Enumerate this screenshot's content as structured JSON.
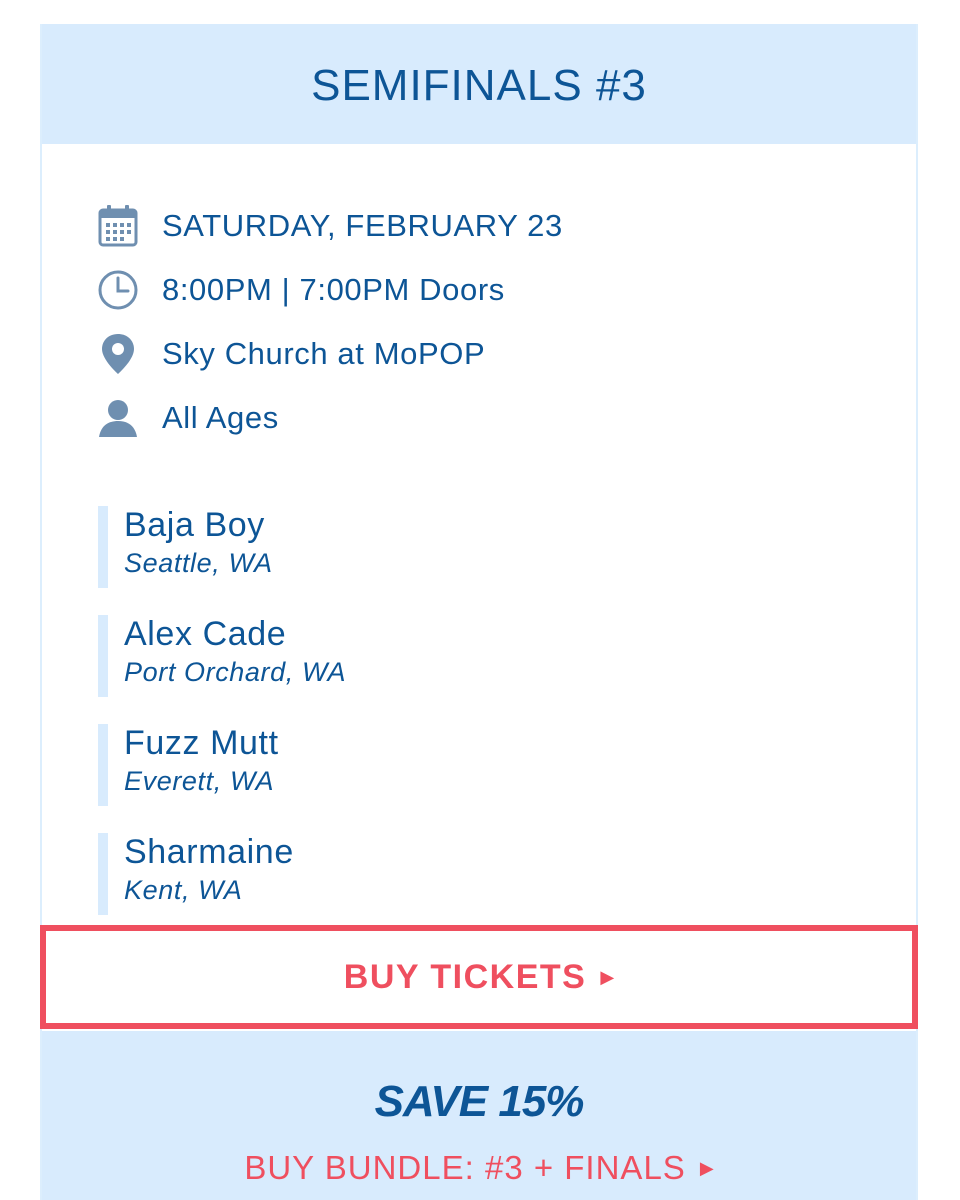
{
  "event": {
    "title": "SEMIFINALS #3",
    "date": "SATURDAY, FEBRUARY 23",
    "time": "8:00PM | 7:00PM Doors",
    "venue": "Sky Church at MoPOP",
    "ages": "All Ages"
  },
  "lineup": [
    {
      "name": "Baja Boy",
      "origin": "Seattle, WA"
    },
    {
      "name": "Alex Cade",
      "origin": "Port Orchard, WA"
    },
    {
      "name": "Fuzz Mutt",
      "origin": "Everett, WA"
    },
    {
      "name": "Sharmaine",
      "origin": "Kent, WA"
    }
  ],
  "actions": {
    "buy_tickets": "BUY TICKETS",
    "save_text": "SAVE 15%",
    "bundle": "BUY BUNDLE: #3 + FINALS"
  },
  "icons": {
    "date": "calendar-icon",
    "time": "clock-icon",
    "venue": "location-pin-icon",
    "ages": "person-icon",
    "arrow": "triangle-right-icon"
  },
  "colors": {
    "primary": "#0d5596",
    "accent": "#ef4f5f",
    "panel": "#d8ebfd",
    "icon": "#6f8fb0"
  }
}
